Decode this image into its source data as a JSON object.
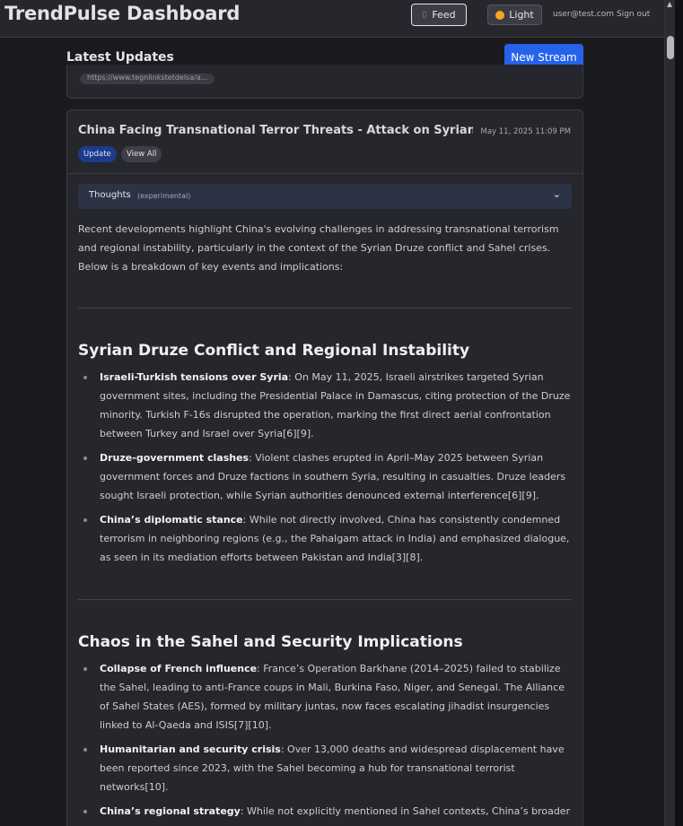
{
  "header": {
    "brand": "TrendPulse Dashboard",
    "feed_label": "Feed",
    "light_label": "Light",
    "user_email": "user@test.com",
    "signout_label": "Sign out"
  },
  "section": {
    "title": "Latest Updates",
    "new_stream_label": "New Stream"
  },
  "prev_card": {
    "link_text": "https://www.tegnlinkstetdelsa/a..."
  },
  "card": {
    "title": "China Facing Transnational Terror Threats - Attack on Syrian Druz...",
    "date": "May 11, 2025 11:09 PM",
    "tag_update": "Update",
    "tag_viewall": "View All",
    "thoughts_label": "Thoughts",
    "thoughts_note": "(experimental)",
    "intro": "Recent developments highlight China's evolving challenges in addressing transnational terrorism and regional instability, particularly in the context of the Syrian Druze conflict and Sahel crises. Below is a breakdown of key events and implications:",
    "sections": [
      {
        "heading": "Syrian Druze Conflict and Regional Instability",
        "items": [
          {
            "bold": "Israeli-Turkish tensions over Syria",
            "text": ": On May 11, 2025, Israeli airstrikes targeted Syrian government sites, including the Presidential Palace in Damascus, citing protection of the Druze minority. Turkish F-16s disrupted the operation, marking the first direct aerial confrontation between Turkey and Israel over Syria[6][9]."
          },
          {
            "bold": "Druze-government clashes",
            "text": ": Violent clashes erupted in April–May 2025 between Syrian government forces and Druze factions in southern Syria, resulting in casualties. Druze leaders sought Israeli protection, while Syrian authorities denounced external interference[6][9]."
          },
          {
            "bold": "China’s diplomatic stance",
            "text": ": While not directly involved, China has consistently condemned terrorism in neighboring regions (e.g., the Pahalgam attack in India) and emphasized dialogue, as seen in its mediation efforts between Pakistan and India[3][8]."
          }
        ]
      },
      {
        "heading": "Chaos in the Sahel and Security Implications",
        "items": [
          {
            "bold": "Collapse of French influence",
            "text": ": France’s Operation Barkhane (2014–2025) failed to stabilize the Sahel, leading to anti-France coups in Mali, Burkina Faso, Niger, and Senegal. The Alliance of Sahel States (AES), formed by military juntas, now faces escalating jihadist insurgencies linked to Al-Qaeda and ISIS[7][10]."
          },
          {
            "bold": "Humanitarian and security crisis",
            "text": ": Over 13,000 deaths and widespread displacement have been reported since 2023, with the Sahel becoming a hub for transnational terrorist networks[10]."
          },
          {
            "bold": "China’s regional strategy",
            "text": ": While not explicitly mentioned in Sahel contexts, China’s broader approach integrates security with socio-economic development, as seen in Central Asia through"
          }
        ]
      }
    ]
  },
  "colors": {
    "accent": "#2563eb",
    "tag_update": "#1e3a8a",
    "background": "#1b1b1f",
    "card": "#26272c"
  },
  "icons": {
    "feed": "feed-icon",
    "light": "sun-icon",
    "thoughts_toggle": "chevron-down-icon"
  }
}
